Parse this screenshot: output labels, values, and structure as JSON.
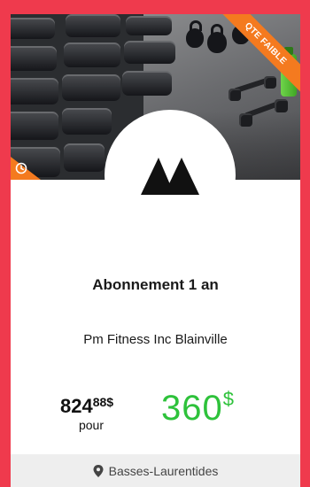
{
  "badge": {
    "label": "QTE FAIBLE",
    "color": "#f47a1f"
  },
  "icons": {
    "timer": "clock-icon",
    "brand": "gym-logo",
    "location": "map-pin-icon"
  },
  "offer": {
    "title": "Abonnement 1 an",
    "merchant": "Pm Fitness Inc Blainville",
    "old_price_main": "824",
    "old_price_cents": "88$",
    "pour_label": "pour",
    "new_price_main": "360",
    "new_price_currency": "$",
    "new_price_color": "#2ec23b"
  },
  "location": {
    "label": "Basses-Laurentides"
  },
  "colors": {
    "page_background": "#ef3a4d",
    "card": "#ffffff",
    "footer": "#eeeeee"
  }
}
